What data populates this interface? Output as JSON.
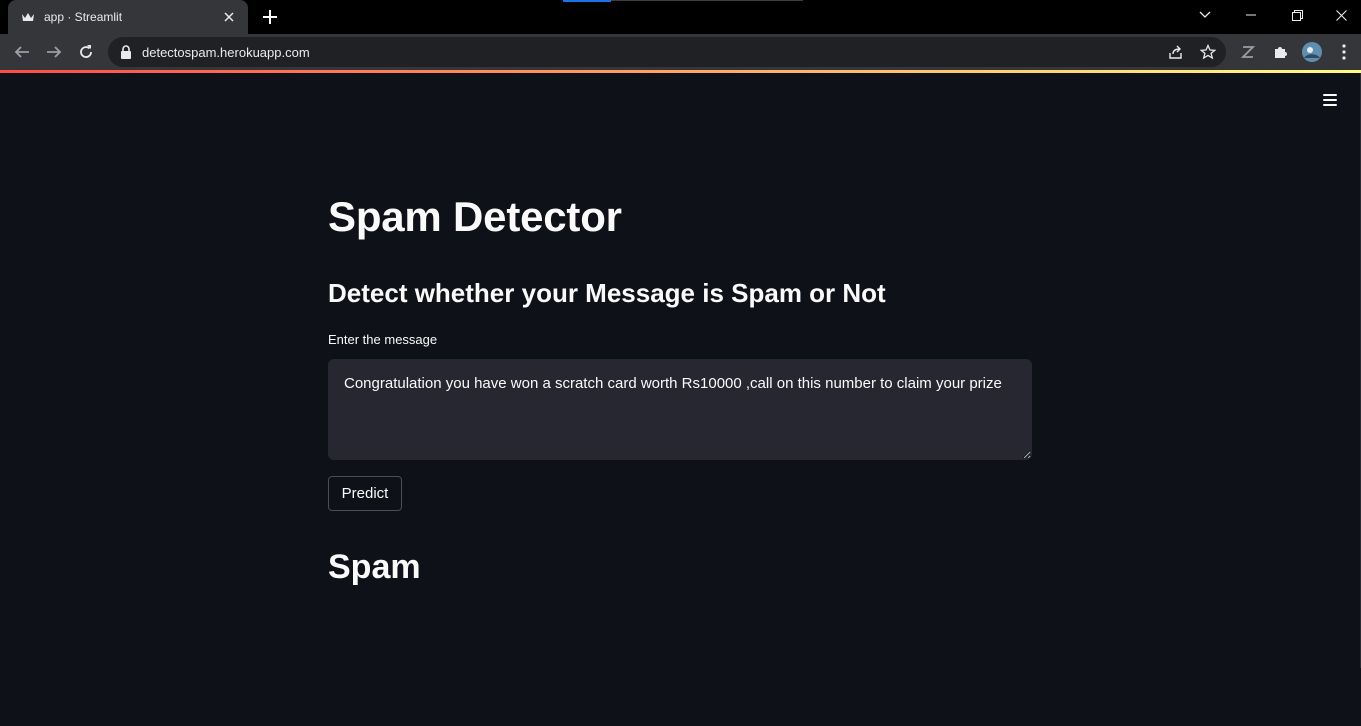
{
  "browser": {
    "tab_title": "app · Streamlit",
    "url": "detectospam.herokuapp.com"
  },
  "app": {
    "title": "Spam Detector",
    "subtitle": "Detect whether your Message is Spam or Not",
    "input_label": "Enter the message",
    "input_value": "Congratulation you have won a scratch card worth Rs10000 ,call on this number to claim your prize",
    "button_label": "Predict",
    "result": "Spam"
  },
  "colors": {
    "background": "#0e1117",
    "input_bg": "#262730",
    "text": "#fafafa",
    "accent_gradient_start": "#ff4b4b",
    "accent_gradient_end": "#fffd80"
  }
}
